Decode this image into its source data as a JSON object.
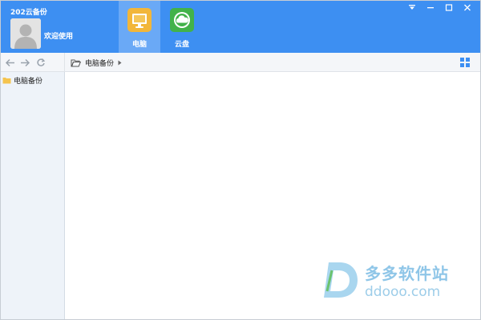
{
  "header": {
    "app_title": "202云备份",
    "welcome": "欢迎使用",
    "tabs": [
      {
        "label": "电脑",
        "icon": "monitor-icon",
        "active": true,
        "color": "#f2b63a"
      },
      {
        "label": "云盘",
        "icon": "cloud-icon",
        "active": false,
        "color": "#42b24a"
      }
    ],
    "window_controls": [
      "menu-dropdown-icon",
      "minimize-icon",
      "maximize-icon",
      "close-icon"
    ]
  },
  "toolbar": {
    "breadcrumb": "电脑备份"
  },
  "sidebar": {
    "items": [
      {
        "label": "电脑备份",
        "icon": "folder-icon"
      }
    ]
  },
  "watermark": {
    "name": "多多软件站",
    "url": "ddooo.com"
  },
  "colors": {
    "header": "#3d8ff2",
    "active_tab": "#6aa9f6",
    "sidebar": "#eef3f9"
  }
}
